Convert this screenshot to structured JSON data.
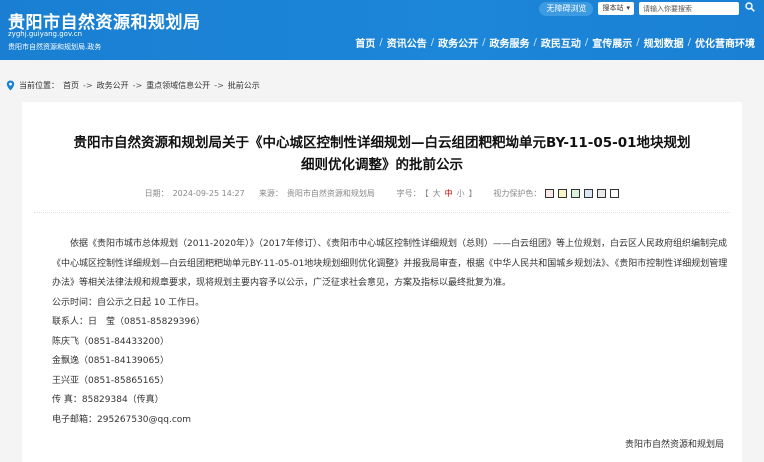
{
  "header": {
    "title": "贵阳市自然资源和规划局",
    "domain": "zyghj.guiyang.gov.cn",
    "subtitle": "贵阳市自然资源和规划局.政务",
    "accessible_label": "无障碍浏览",
    "search_scope": "搜本站",
    "search_placeholder": "请输入你要搜索",
    "nav": [
      "首页",
      "资讯公告",
      "政务公开",
      "政务服务",
      "政民互动",
      "宣传展示",
      "规划数据",
      "优化营商环境"
    ]
  },
  "breadcrumb": {
    "prefix": "当前位置：",
    "items": [
      "首页",
      "政务公开",
      "重点领域信息公开",
      "批前公示"
    ],
    "separator": "->"
  },
  "article": {
    "title_line1": "贵阳市自然资源和规划局关于《中心城区控制性详细规划—白云组团粑粑坳单元BY-11-05-01地块规划",
    "title_line2": "细则优化调整》的批前公示",
    "date_label": "日期：",
    "date": "2024-09-25 14:27",
    "source_label": "来源：",
    "source": "贵阳市自然资源和规划局",
    "fontsize_label": "字号：",
    "size_open": "【",
    "size_large": "大",
    "size_mid": "中",
    "size_small": "小",
    "size_close": "】",
    "vision_label": "视力保护色：",
    "vision_colors": [
      "#fae7e7",
      "#faf7c7",
      "#d9f1d9",
      "#dbe7f5",
      "#e8e8e8",
      "#ffffff"
    ],
    "paragraph": "依据《贵阳市城市总体规划（2011-2020年）》（2017年修订）、《贵阳市中心城区控制性详细规划（总则）——白云组团》等上位规划，白云区人民政府组织编制完成《中心城区控制性详细规划—白云组团粑粑坳单元BY-11-05-01地块规划细则优化调整》并报我局审查，根据《中华人民共和国城乡规划法》、《贵阳市控制性详细规划管理办法》等相关法律法规和规章要求，现将规划主要内容予以公示，广泛征求社会意见，方案及指标以最终批复为准。",
    "lines": [
      "公示时间：自公示之日起 10 工作日。",
      "联系人：日　莹（0851-85829396）",
      "陈庆飞（0851-84433200）",
      "金飘逸（0851-84139065）",
      "王兴亚（0851-85865165）",
      "传 真：85829384（传真）",
      "电子邮箱：295267530@qq.com"
    ],
    "signature": "贵阳市自然资源和规划局"
  }
}
